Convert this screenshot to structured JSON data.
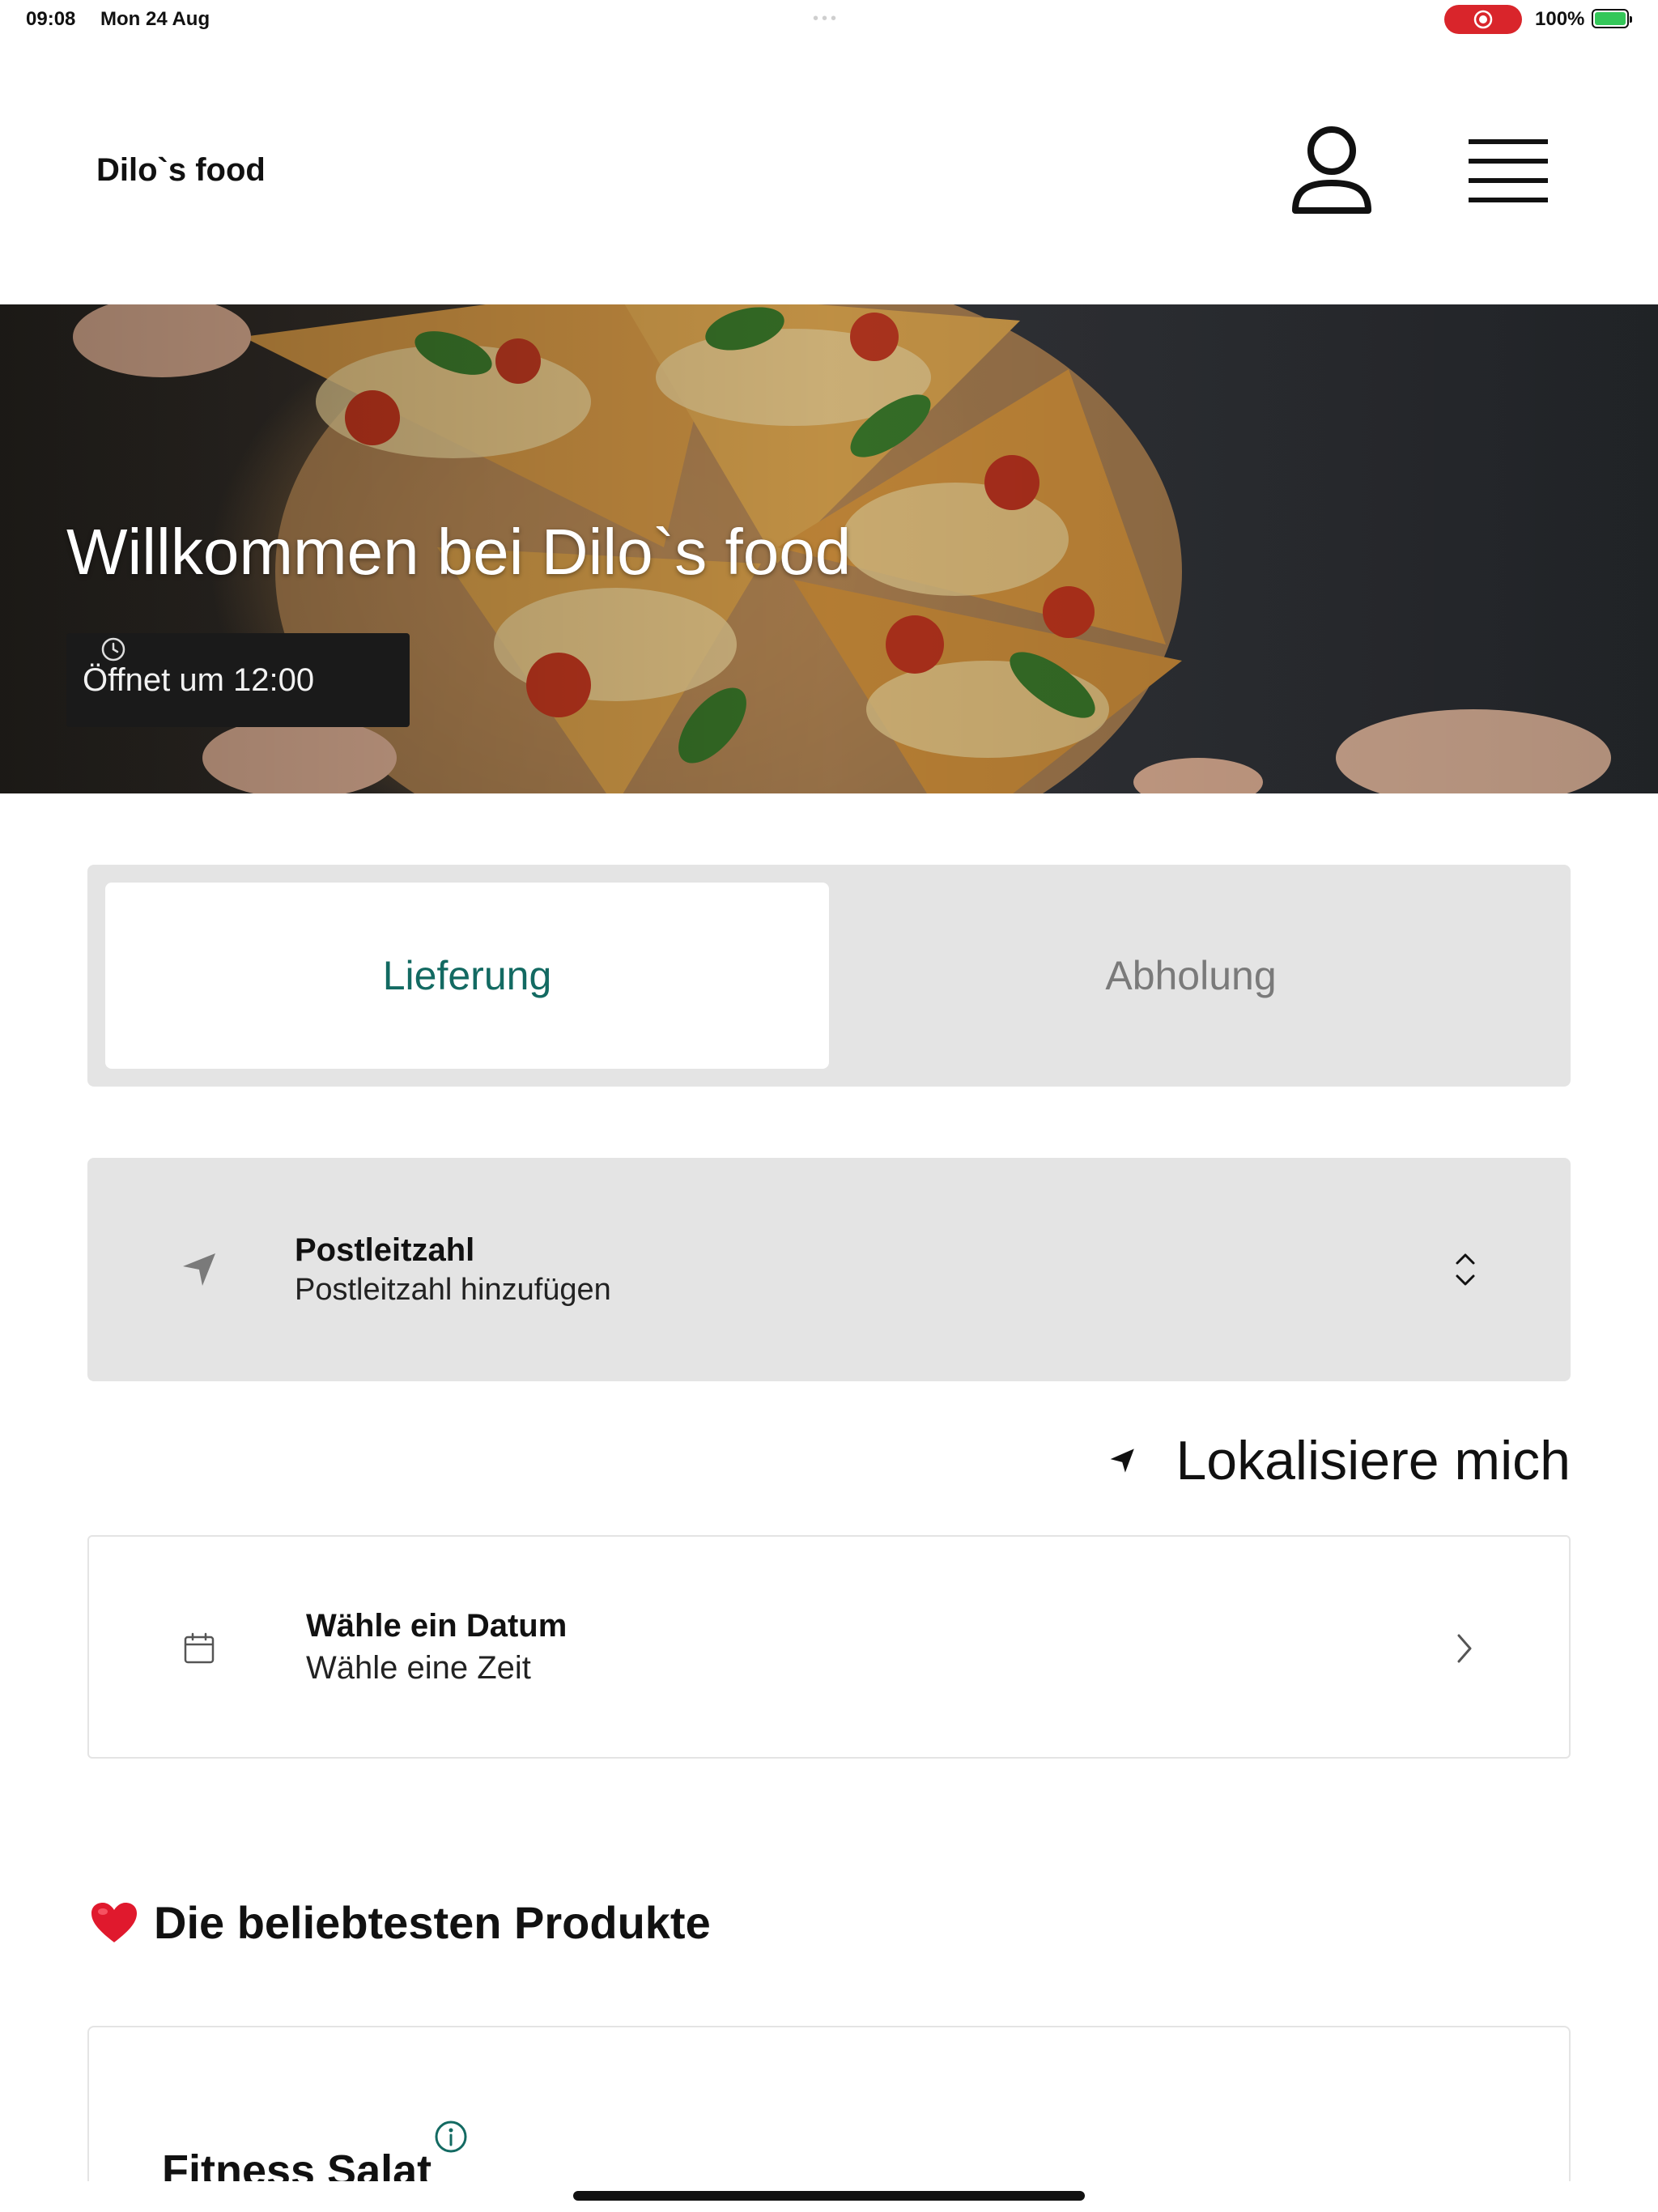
{
  "status_bar": {
    "time": "09:08",
    "date": "Mon 24 Aug",
    "battery_percent": "100%",
    "recording_color": "#d9252b",
    "battery_color": "#34c759"
  },
  "header": {
    "brand": "Dilo`s food",
    "profile_icon": "person-icon",
    "menu_icon": "hamburger-menu-icon"
  },
  "hero": {
    "title": "Willkommen bei Dilo`s food",
    "opening_hours": "Öffnet um 12:00",
    "clock_icon": "clock-icon",
    "image": "pizza-photo"
  },
  "order_type": {
    "tabs": [
      {
        "label": "Lieferung",
        "active": true
      },
      {
        "label": "Abholung",
        "active": false
      }
    ],
    "active_color": "#136a62"
  },
  "zip_select": {
    "label": "Postleitzahl",
    "placeholder": "Postleitzahl hinzufügen",
    "icon": "navigation-arrow-icon"
  },
  "locate": {
    "label": "Lokalisiere mich",
    "icon": "location-arrow-icon"
  },
  "date_select": {
    "label": "Wähle ein Datum",
    "value": "Wähle eine Zeit",
    "icon": "calendar-icon"
  },
  "popular": {
    "title": "Die beliebtesten Produkte",
    "icon": "heart-icon",
    "products": [
      {
        "name": "Fitness Salat"
      }
    ]
  }
}
